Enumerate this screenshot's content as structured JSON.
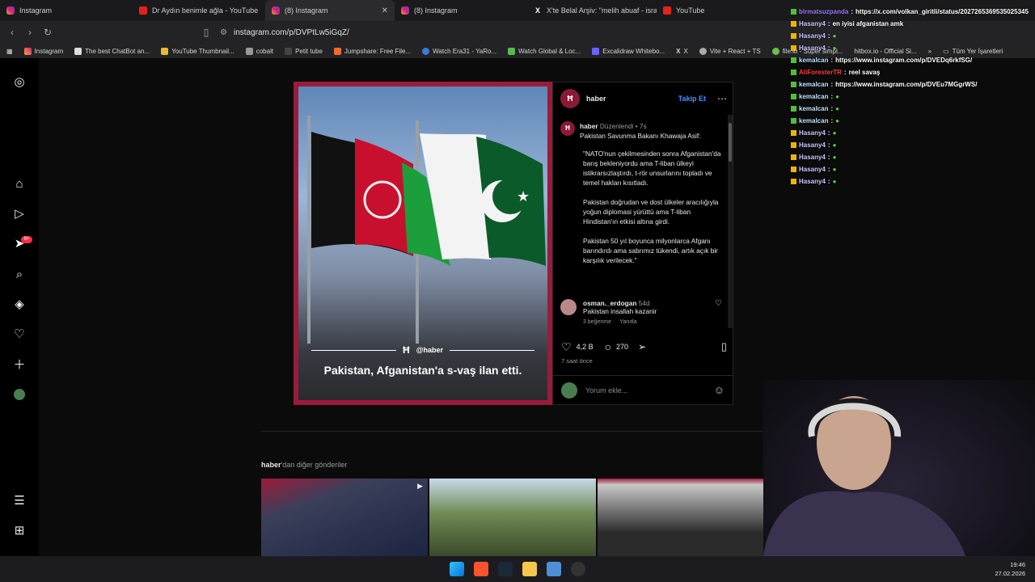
{
  "tabs": [
    {
      "label": "Instagram",
      "icon": "instagram-icon"
    },
    {
      "label": "Dr Aydın benimle ağla - YouTube",
      "icon": "youtube-icon"
    },
    {
      "label": "(8) Instagram",
      "icon": "instagram-icon",
      "active": true
    },
    {
      "label": "(8) Instagram",
      "icon": "instagram-icon"
    },
    {
      "label": "X'te Belal Arşiv: \"melih abuaf - israil ...",
      "icon": "x-icon"
    },
    {
      "label": "YouTube",
      "icon": "youtube-icon"
    }
  ],
  "address": {
    "url": "instagram.com/p/DVPtLw5iGqZ/"
  },
  "bookmarks": [
    "Instagram",
    "The best ChatBot an...",
    "YouTube Thumbnail...",
    "cobalt",
    "Petit tube",
    "Jumpshare: Free File...",
    "Watch Era31 - YaRo...",
    "Watch Global & Loc...",
    "Excalidraw Whitebo...",
    "X",
    "Vite + React + TS",
    "file.io - Super simpl...",
    "hitbox.io - Official Si...",
    "Tüm Yer İşaretleri"
  ],
  "sidebar": {
    "notification_badge": "9+"
  },
  "post": {
    "username": "haber",
    "follow_label": "Takip Et",
    "image_handle": "@haber",
    "image_caption": "Pakistan, Afganistan'a s-vaş ilan etti.",
    "caption_meta": "Düzenlendi • 7s",
    "caption_paragraphs": [
      "Pakistan Savunma Bakanı Khawaja Asif:",
      "\"NATO'nun çekilmesinden sonra Afganistan'da barış bekleniyordu ama T-liban ülkeyi istikrarsızlaştırdı, t-rör unsurlarını topladı ve temel hakları kısıtladı.",
      "Pakistan doğrudan ve dost ülkeler aracılığıyla yoğun diplomasi yürüttü ama T-liban Hindistan'ın etkisi altına girdi.",
      "Pakistan 50 yıl boyunca milyonlarca Afganı barındırdı ama sabrımız tükendi, artık açık bir karşılık verilecek.\""
    ],
    "comment": {
      "user": "osman._erdogan",
      "age": "54d",
      "text": "Pakistan insallah kazanir",
      "likes": "3 beğenme",
      "reply": "Yanıtla"
    },
    "likes": "4,2 B",
    "comments": "270",
    "time": "7 saat önce",
    "add_comment_placeholder": "Yorum ekle..."
  },
  "more_posts": {
    "user": "haber",
    "label": "'dan diğer gönderiler"
  },
  "chat": [
    {
      "user": "birmatsuzpanda",
      "text": "https://x.com/volkan_giritli/status/2027265369535025345",
      "badge": "green"
    },
    {
      "user": "Hasany4",
      "text": "en iyisi afganistan amk",
      "badge": "yellow"
    },
    {
      "user": "Hasany4",
      "text": "",
      "badge": "yellow"
    },
    {
      "user": "Hasany4",
      "text": "",
      "badge": "yellow"
    },
    {
      "user": "kemalcan",
      "text": "https://www.instagram.com/p/DVEDq6rkfSG/",
      "badge": "green"
    },
    {
      "user": "AliForesterTR",
      "text": "reel savaş",
      "badge": "green"
    },
    {
      "user": "kemalcan",
      "text": "https://www.instagram.com/p/DVEu7MGgrWS/",
      "badge": "green"
    },
    {
      "user": "kemalcan",
      "text": "",
      "badge": "green"
    },
    {
      "user": "kemalcan",
      "text": "",
      "badge": "green"
    },
    {
      "user": "kemalcan",
      "text": "",
      "badge": "green"
    },
    {
      "user": "Hasany4",
      "text": "",
      "badge": "yellow"
    },
    {
      "user": "Hasany4",
      "text": "",
      "badge": "yellow"
    },
    {
      "user": "Hasany4",
      "text": "",
      "badge": "yellow"
    },
    {
      "user": "Hasany4",
      "text": "",
      "badge": "yellow"
    },
    {
      "user": "Hasany4",
      "text": "",
      "badge": "yellow"
    }
  ],
  "clock": {
    "time": "19:46",
    "date": "27.02.2026"
  }
}
